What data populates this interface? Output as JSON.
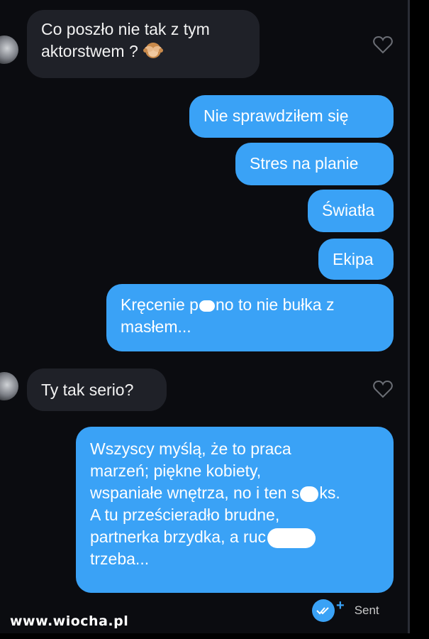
{
  "messages": {
    "in1": {
      "line1": "Co poszło nie tak z tym",
      "line2": "aktorstwem ?"
    },
    "out1": "Nie sprawdziłem się",
    "out2": "Stres na planie",
    "out3": "Światła",
    "out4": "Ekipa",
    "out5": {
      "line1_a": "Kręcenie p",
      "line1_b": "no to nie bułka z",
      "line2": "masłem..."
    },
    "in2": "Ty tak serio?",
    "out6": {
      "line1": "Wszyscy myślą, że to praca",
      "line2": "marzeń; piękne kobiety,",
      "line3_a": "wspaniałe wnętrza, no i ten s",
      "line3_b": "ks.",
      "line4": "A tu prześcieradło brudne,",
      "line5_a": "partnerka brzydka, a ruc",
      "line6": "trzeba..."
    }
  },
  "status": {
    "sent_label": "Sent",
    "plus": "+"
  },
  "watermark": "www.wiocha.pl",
  "colors": {
    "outgoing": "#3aa2f6",
    "incoming": "#1f2128",
    "background": "#0b0c10"
  },
  "icons": {
    "like": "heart-icon",
    "read": "double-check-icon",
    "emoji": "see-no-evil-monkey-icon"
  }
}
